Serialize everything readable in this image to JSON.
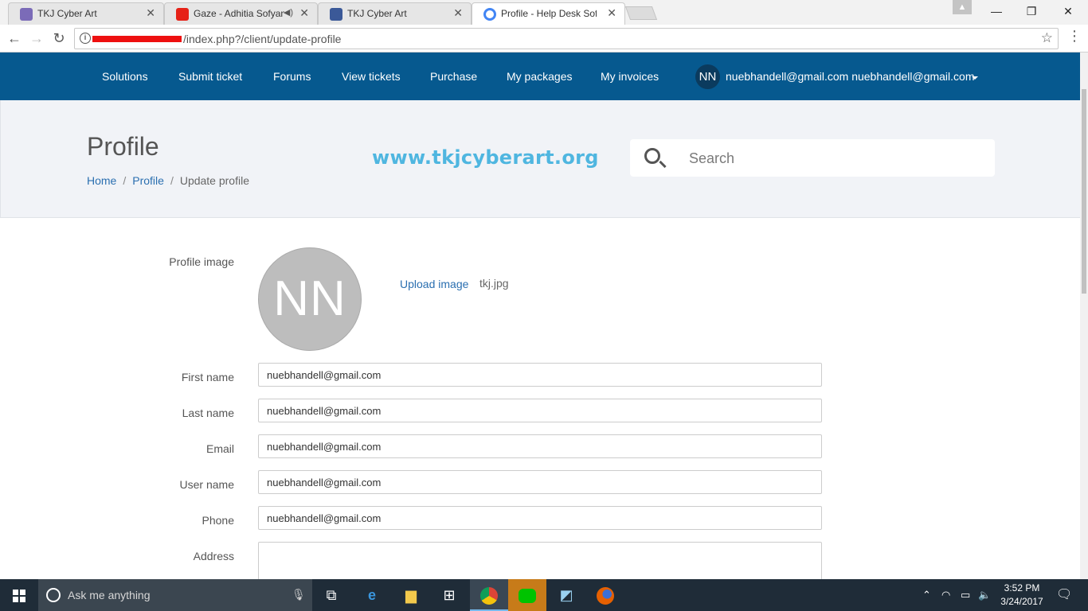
{
  "browser": {
    "tabs": [
      {
        "title": "TKJ Cyber Art",
        "favicon_color": "#7b6bb8"
      },
      {
        "title": "Gaze - Adhitia Sofyan",
        "favicon_color": "#e62117"
      },
      {
        "title": "TKJ Cyber Art",
        "favicon_color": "#3b5998"
      },
      {
        "title": "Profile - Help Desk Softw",
        "favicon_color": "#4285f4"
      }
    ],
    "address": "/index.php?/client/update-profile",
    "window_controls": {
      "minimize": "—",
      "maximize": "❐",
      "close": "✕"
    },
    "profile_chip": "▲"
  },
  "site": {
    "nav": {
      "items": [
        "Solutions",
        "Submit ticket",
        "Forums",
        "View tickets",
        "Purchase",
        "My packages",
        "My invoices"
      ],
      "user_initials": "NN",
      "user_name": "nuebhandell@gmail.com nuebhandell@gmail.com"
    },
    "hero": {
      "title": "Profile",
      "breadcrumb": [
        "Home",
        "Profile",
        "Update profile"
      ],
      "watermark": "www.tkjcyberart.org",
      "search_placeholder": "Search"
    },
    "form": {
      "profile_image_label": "Profile image",
      "avatar_initials": "NN",
      "upload_label": "Upload image",
      "filename": "tkj.jpg",
      "fields": [
        {
          "label": "First name",
          "value": "nuebhandell@gmail.com"
        },
        {
          "label": "Last name",
          "value": "nuebhandell@gmail.com"
        },
        {
          "label": "Email",
          "value": "nuebhandell@gmail.com"
        },
        {
          "label": "User name",
          "value": "nuebhandell@gmail.com"
        },
        {
          "label": "Phone",
          "value": "nuebhandell@gmail.com"
        }
      ],
      "address_label": "Address"
    }
  },
  "taskbar": {
    "search_placeholder": "Ask me anything",
    "time": "3:52 PM",
    "date": "3/24/2017"
  },
  "colors": {
    "nav_bg": "#06598f",
    "hero_bg": "#f1f3f7",
    "link": "#2a6fb0",
    "taskbar_bg": "#1f2c38"
  }
}
